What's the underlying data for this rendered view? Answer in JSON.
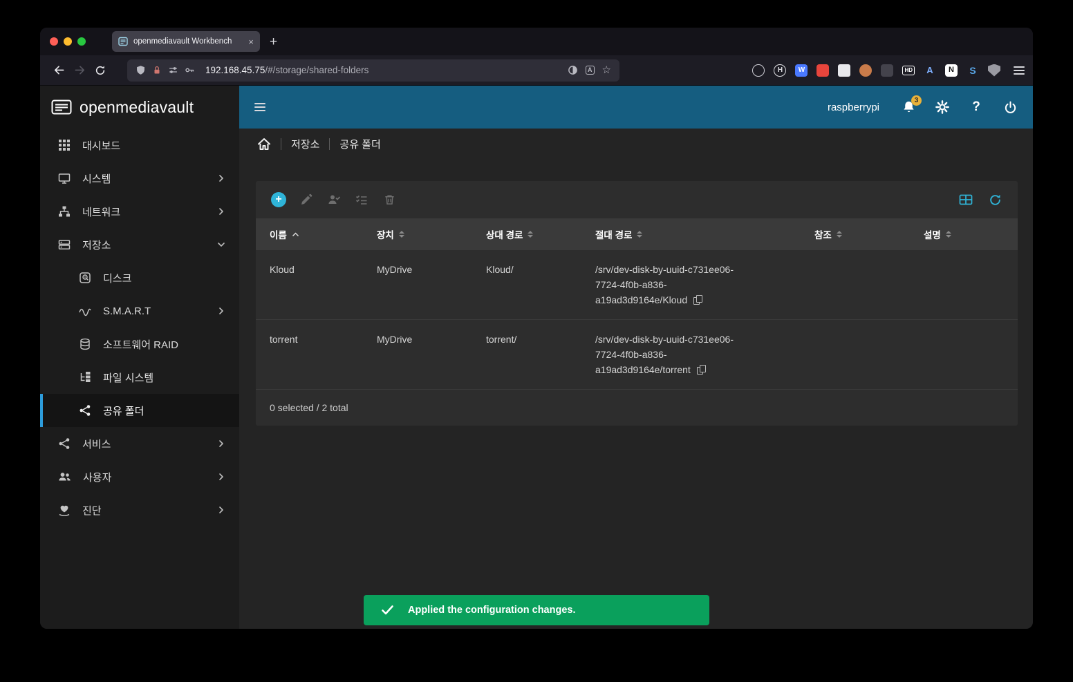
{
  "glyphs": {
    "close": "×",
    "plus": "+",
    "question": "?",
    "star": "☆",
    "translate_a": "A"
  },
  "browser": {
    "tab_title": "openmediavault Workbench",
    "url_host": "192.168.45.75",
    "url_path": "/#/storage/shared-folders",
    "extensions": [
      {
        "name": "pocket",
        "glyph": ""
      },
      {
        "name": "account",
        "glyph": "H"
      },
      {
        "name": "wiz",
        "glyph": "W"
      },
      {
        "name": "password-manager",
        "glyph": ""
      },
      {
        "name": "screenshot",
        "glyph": ""
      },
      {
        "name": "pet",
        "glyph": ""
      },
      {
        "name": "container",
        "glyph": ""
      },
      {
        "name": "hd",
        "glyph": "HD"
      },
      {
        "name": "translate",
        "glyph": "A"
      },
      {
        "name": "notion",
        "glyph": "N"
      },
      {
        "name": "synology",
        "glyph": "S"
      },
      {
        "name": "vpn-shield",
        "glyph": ""
      }
    ]
  },
  "header": {
    "logo": "openmediavault",
    "hostname": "raspberrypi",
    "notification_count": "3"
  },
  "sidebar": {
    "items": [
      {
        "label": "대시보드",
        "icon": "dashboard"
      },
      {
        "label": "시스템",
        "icon": "system"
      },
      {
        "label": "네트워크",
        "icon": "network"
      },
      {
        "label": "저장소",
        "icon": "storage"
      },
      {
        "label": "디스크",
        "icon": "disk"
      },
      {
        "label": "S.M.A.R.T",
        "icon": "smart"
      },
      {
        "label": "소프트웨어 RAID",
        "icon": "raid"
      },
      {
        "label": "파일 시스템",
        "icon": "filesystem"
      },
      {
        "label": "공유 폴더",
        "icon": "shared-folder"
      },
      {
        "label": "서비스",
        "icon": "services"
      },
      {
        "label": "사용자",
        "icon": "users"
      },
      {
        "label": "진단",
        "icon": "diagnostics"
      }
    ]
  },
  "breadcrumb": {
    "items": [
      "저장소",
      "공유 폴더"
    ]
  },
  "table": {
    "columns": [
      "이름",
      "장치",
      "상대 경로",
      "절대 경로",
      "참조",
      "설명"
    ],
    "sort": {
      "column": "이름",
      "direction": "asc"
    },
    "rows": [
      {
        "name": "Kloud",
        "device": "MyDrive",
        "relative_path": "Kloud/",
        "absolute_path": "/srv/dev-disk-by-uuid-c731ee06-7724-4f0b-a836-a19ad3d9164e/Kloud",
        "referenced": "",
        "description": ""
      },
      {
        "name": "torrent",
        "device": "MyDrive",
        "relative_path": "torrent/",
        "absolute_path": "/srv/dev-disk-by-uuid-c731ee06-7724-4f0b-a836-a19ad3d9164e/torrent",
        "referenced": "",
        "description": ""
      }
    ],
    "footer": "0 selected / 2 total"
  },
  "toast": {
    "message": "Applied the configuration changes."
  },
  "colors": {
    "accent": "#2fb4d8",
    "toast_green": "#0aa05c",
    "header_blue": "#155d80",
    "badge_yellow": "#e9b23a",
    "active_indicator": "#2d9cdb"
  }
}
